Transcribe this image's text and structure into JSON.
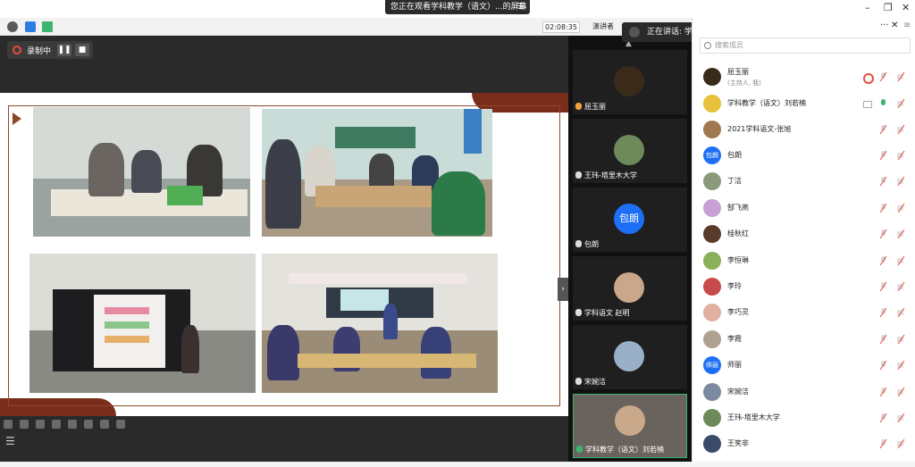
{
  "banner": {
    "text": "您正在观看学科教学（语文）...的屏幕",
    "end": "☰"
  },
  "window": {
    "minimize": "–",
    "restore": "❐",
    "close": "✕"
  },
  "toolbar": {
    "timer": "02:08:35",
    "speaker_view": "演讲者"
  },
  "speaking": {
    "text": "正在讲话: 学科教学（语文..."
  },
  "recording": {
    "label": "录制中",
    "pause": "❚❚",
    "stop": "■"
  },
  "panel": {
    "more": "···",
    "close": "✕",
    "search_placeholder": "搜索成员"
  },
  "video_tiles": [
    {
      "name": "屈玉丽",
      "avatar_color": "#3a2a1a"
    },
    {
      "name": "王玮-塔里木大学",
      "avatar_color": "#6e8a5a"
    },
    {
      "name": "包朗",
      "avatar_text": "包朗",
      "avatar_color": "#1e6ff5"
    },
    {
      "name": "学科语文 赵明",
      "avatar_color": "#c9a78a"
    },
    {
      "name": "宋婉洁",
      "avatar_color": "#9ab0c8"
    },
    {
      "name": "学科教学（语文）刘若楠",
      "avatar_color": "#c9a98a"
    }
  ],
  "participants": [
    {
      "name": "屈玉丽",
      "sub": "(主持人, 我)",
      "avatar_color": "#3a2a1a",
      "recording": true
    },
    {
      "name": "学科教学（语文）刘若楠",
      "avatar_color": "#e8c23a",
      "mic_on": true,
      "screen": true
    },
    {
      "name": "2021学科语文-张旭",
      "avatar_color": "#a07850"
    },
    {
      "name": "包朗",
      "avatar_text": "包朗",
      "avatar_color": "#1e6ff5"
    },
    {
      "name": "丁洁",
      "avatar_color": "#8a9a7a"
    },
    {
      "name": "郜飞燕",
      "avatar_color": "#c8a0d8"
    },
    {
      "name": "桂秋红",
      "avatar_color": "#5a3a2a"
    },
    {
      "name": "李恒琳",
      "avatar_color": "#8ab05a"
    },
    {
      "name": "李玲",
      "avatar_color": "#c84a4a"
    },
    {
      "name": "李巧灵",
      "avatar_color": "#e0b0a0"
    },
    {
      "name": "李霞",
      "avatar_color": "#b0a090"
    },
    {
      "name": "师丽",
      "avatar_text": "师丽",
      "avatar_color": "#1e6ff5"
    },
    {
      "name": "宋婉洁",
      "avatar_color": "#7a8aa0"
    },
    {
      "name": "王玮-塔里木大学",
      "avatar_color": "#6e8a5a"
    },
    {
      "name": "王笑非",
      "avatar_color": "#3a4a6a"
    }
  ]
}
